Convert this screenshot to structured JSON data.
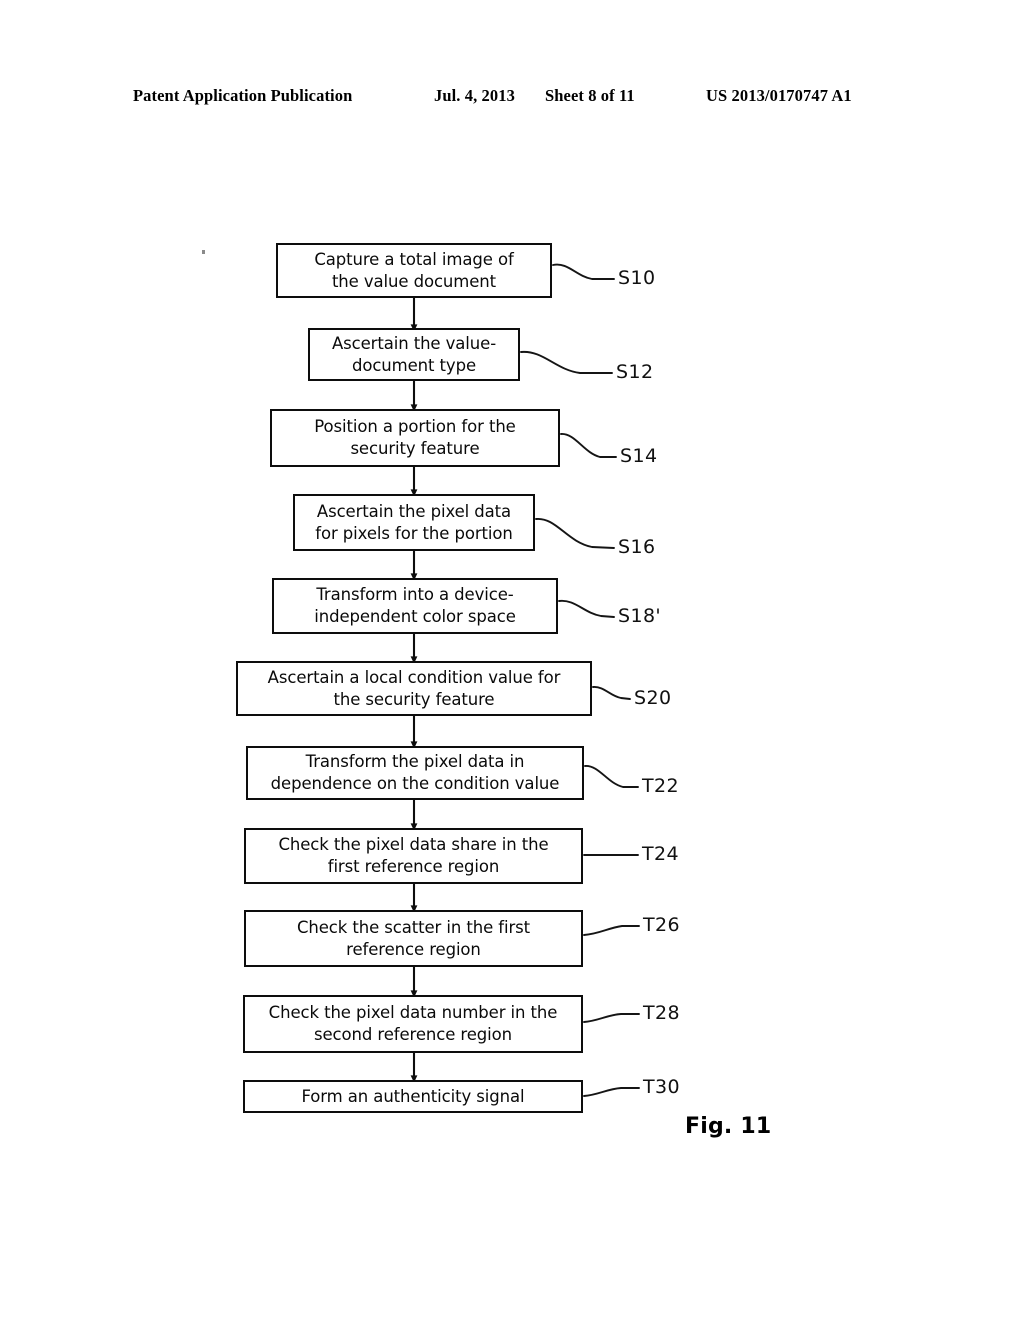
{
  "header": {
    "publication": "Patent Application Publication",
    "date": "Jul. 4, 2013",
    "sheet": "Sheet 8 of 11",
    "patent_number": "US 2013/0170747 A1"
  },
  "figure": {
    "caption": "Fig. 11",
    "type": "flowchart",
    "orientation": "top-to-bottom"
  },
  "chart_data": {
    "type": "flowchart",
    "title": "Fig. 11",
    "nodes": [
      {
        "id": "S10",
        "label": "Capture a total image of the value document",
        "line1": "Capture a total image of",
        "line2": "the value document"
      },
      {
        "id": "S12",
        "label": "Ascertain the value-document type",
        "line1": "Ascertain the value-",
        "line2": "document type"
      },
      {
        "id": "S14",
        "label": "Position a portion for the security feature",
        "line1": "Position a portion for the",
        "line2": "security feature"
      },
      {
        "id": "S16",
        "label": "Ascertain the pixel data for pixels for the portion",
        "line1": "Ascertain the pixel data",
        "line2": "for pixels for the portion"
      },
      {
        "id": "S18'",
        "label": "Transform into a device-independent color space",
        "line1": "Transform into a device-",
        "line2": "independent color space"
      },
      {
        "id": "S20",
        "label": "Ascertain a local condition value for the security feature",
        "line1": "Ascertain a local condition value for",
        "line2": "the security feature"
      },
      {
        "id": "T22",
        "label": "Transform the pixel data in dependence on the condition value",
        "line1": "Transform the pixel data in",
        "line2": "dependence on the condition value"
      },
      {
        "id": "T24",
        "label": "Check the pixel data share in the first reference region",
        "line1": "Check the pixel data share in the",
        "line2": "first reference region"
      },
      {
        "id": "T26",
        "label": "Check the scatter in the first reference region",
        "line1": "Check the scatter in the first",
        "line2": "reference region"
      },
      {
        "id": "T28",
        "label": "Check the pixel data number in the second reference region",
        "line1": "Check the pixel data number in the",
        "line2": "second reference region"
      },
      {
        "id": "T30",
        "label": "Form an authenticity signal",
        "line1": "Form an authenticity signal",
        "line2": ""
      }
    ],
    "edges": [
      {
        "from": "S10",
        "to": "S12"
      },
      {
        "from": "S12",
        "to": "S14"
      },
      {
        "from": "S14",
        "to": "S16"
      },
      {
        "from": "S16",
        "to": "S18'"
      },
      {
        "from": "S18'",
        "to": "S20"
      },
      {
        "from": "S20",
        "to": "T22"
      },
      {
        "from": "T22",
        "to": "T24"
      },
      {
        "from": "T24",
        "to": "T26"
      },
      {
        "from": "T26",
        "to": "T28"
      },
      {
        "from": "T28",
        "to": "T30"
      }
    ]
  },
  "colors": {
    "background": "#ffffff",
    "ink": "#000000",
    "box_border": "#0d0d0d"
  }
}
